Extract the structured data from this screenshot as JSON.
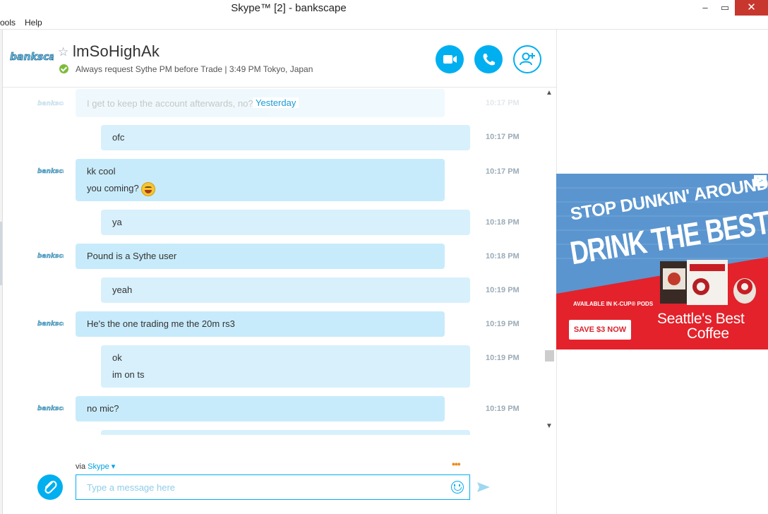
{
  "window": {
    "title": "Skype™ [2] - bankscape",
    "minimize": "–",
    "maximize": "▭",
    "close": "✕"
  },
  "menu": {
    "tools": "ools",
    "help": "Help"
  },
  "header": {
    "contact_name": "lmSoHighAk",
    "mood": "Always request Sythe PM before Trade  |  3:49 PM Tokyo, Japan",
    "accent": "#00aff0",
    "status_color": "#7dbb3a"
  },
  "conversation": {
    "date_separator": "Yesterday",
    "messages": [
      {
        "from": "contact",
        "lines": [
          "I get to keep the account afterwards, no?"
        ],
        "time": "10:17 PM",
        "faded": true
      },
      {
        "from": "me",
        "lines": [
          "ofc"
        ],
        "time": "10:17 PM"
      },
      {
        "from": "contact",
        "lines": [
          "kk cool",
          "you coming?"
        ],
        "time": "10:17 PM",
        "emoji": "smile-tongue"
      },
      {
        "from": "me",
        "lines": [
          "ya"
        ],
        "time": "10:18 PM"
      },
      {
        "from": "contact",
        "lines": [
          "Pound is a Sythe user"
        ],
        "time": "10:18 PM"
      },
      {
        "from": "me",
        "lines": [
          "yeah"
        ],
        "time": "10:19 PM"
      },
      {
        "from": "contact",
        "lines": [
          "He's the one trading me the 20m rs3"
        ],
        "time": "10:19 PM"
      },
      {
        "from": "me",
        "lines": [
          "ok",
          "im on ts"
        ],
        "time": "10:19 PM"
      },
      {
        "from": "contact",
        "lines": [
          "no mic?"
        ],
        "time": "10:19 PM"
      }
    ]
  },
  "compose": {
    "via": "via",
    "service": "Skype",
    "placeholder": "Type a message here",
    "more": "•••"
  },
  "ad": {
    "headline_small": "STOP DUNKIN' AROUND",
    "headline_big": "DRINK THE BEST",
    "fine_print": "AVAILABLE IN K-CUP® PODS",
    "cta": "SAVE $3 NOW",
    "brand_line1": "Seattle's Best",
    "brand_line2": "Coffee",
    "choices": "▷",
    "colors": {
      "blue": "#5a95cf",
      "red": "#e3222b"
    }
  }
}
